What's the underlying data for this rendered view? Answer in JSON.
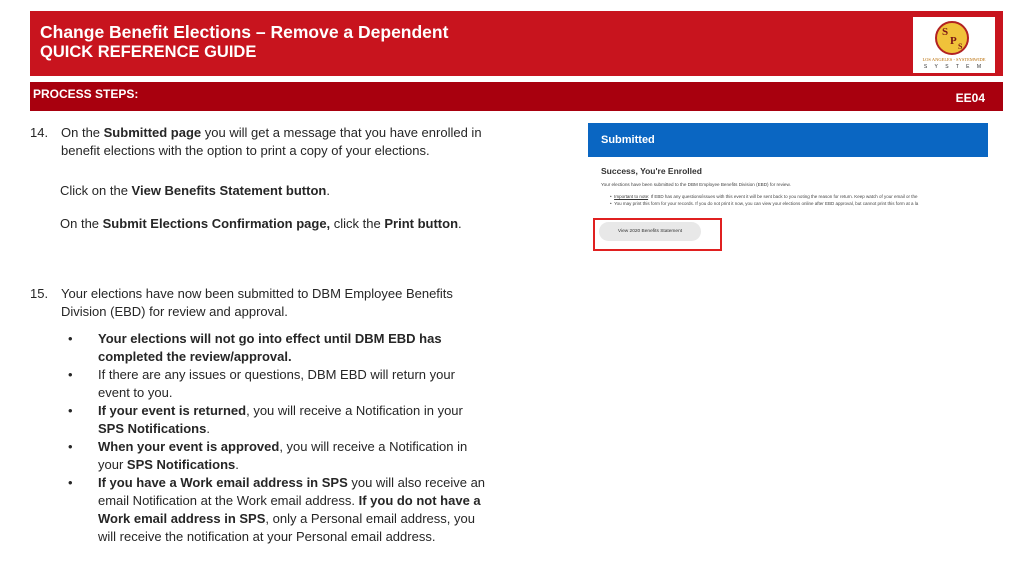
{
  "header": {
    "title": "Change Benefit Elections – Remove a Dependent",
    "subtitle": "QUICK REFERENCE GUIDE",
    "logo": {
      "initials_s": "S",
      "initials_p": "P",
      "initials_s2": "S",
      "line1": "LOS ANGELES - SYSTEMWIDE",
      "line2": "S Y S T E M"
    }
  },
  "process_bar": {
    "label": "PROCESS STEPS:",
    "code": "EE04"
  },
  "step14": {
    "num": "14.",
    "p1_a": "On the ",
    "p1_b": "Submitted page",
    "p1_c": " you will get a message that you have enrolled in benefit elections with the option to print a copy of your elections.",
    "p2_a": "Click on the ",
    "p2_b": "View Benefits Statement button",
    "p2_c": ".",
    "p3_a": "On the ",
    "p3_b": "Submit Elections Confirmation page,",
    "p3_c": " click the ",
    "p3_d": "Print button",
    "p3_e": "."
  },
  "step15": {
    "num": "15.",
    "text": "Your elections have now been submitted to DBM Employee Benefits Division (EBD) for review and approval.",
    "bullet_char": "•",
    "b1": "Your elections will not go into effect until DBM EBD has completed the review/approval.",
    "b2": "If there are any issues or questions, DBM EBD will return your event to you.",
    "b3_a": "If your event is returned",
    "b3_b": ", you will receive a Notification in your ",
    "b3_c": "SPS Notifications",
    "b3_d": ".",
    "b4_a": "When your event is approved",
    "b4_b": ", you will receive a Notification in your ",
    "b4_c": "SPS Notifications",
    "b4_d": ".",
    "b5_a": "If you have a Work email address in SPS",
    "b5_b": " you will also receive an email Notification at the Work email address.  ",
    "b5_c": "If you do not have a Work email address in SPS",
    "b5_d": ", only a Personal email address, you will receive the notification at your Personal email address."
  },
  "screenshot": {
    "bar_title": "Submitted",
    "success": "Success, You're Enrolled",
    "line1": "Your elections have been submitted to the DBM Employee Benefits Division (EBD) for review.",
    "bullet1_a": "Important to note",
    "bullet1_b": ": If EBD has any questions/issues with this event it will be sent back to you noting the reason for return.  Keep watch of your email or the",
    "bullet2": "You may print this form for your records. If you do not print it now, you can view your elections online after EBD approval, but cannot print this form at a la",
    "button": "View 2020 Benefits Statement"
  },
  "colors": {
    "header_red": "#c8141e",
    "bar_dark_red": "#a8000e",
    "workday_blue": "#0a66c2",
    "highlight": "#e02020"
  }
}
